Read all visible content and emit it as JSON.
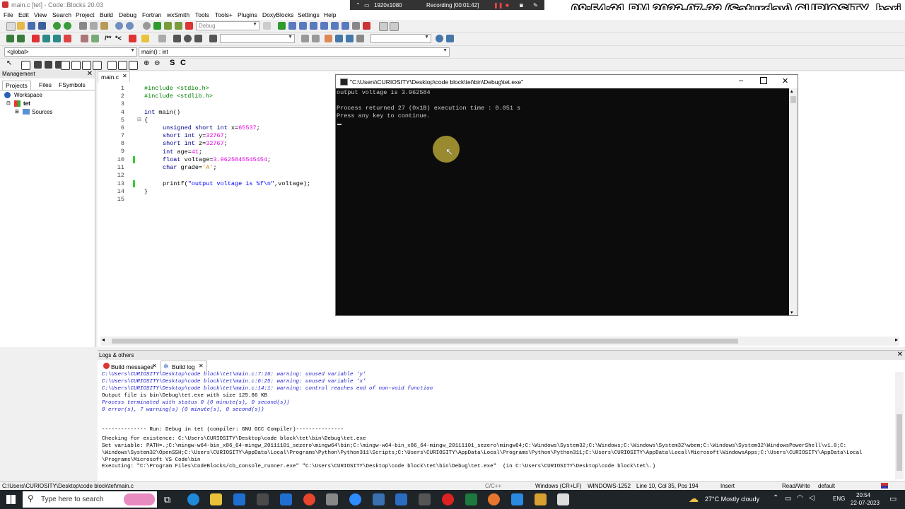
{
  "window": {
    "title": "main.c [tet] - Code::Blocks 20.03"
  },
  "recorder": {
    "resolution": "1920x1080",
    "status": "Recording [00:01:42]"
  },
  "overlay_clock": "08:54:31 PM  2023-07-22 (Saturday) CURIOSITY_hari",
  "menu": [
    "File",
    "Edit",
    "View",
    "Search",
    "Project",
    "Build",
    "Debug",
    "Fortran",
    "wxSmith",
    "Tools",
    "Tools+",
    "Plugins",
    "DoxyBlocks",
    "Settings",
    "Help"
  ],
  "toolbar": {
    "build_target": "Debug",
    "scope": "<global>",
    "symbol": "main() : int"
  },
  "management": {
    "title": "Management",
    "tabs": [
      "Projects",
      "Files",
      "FSymbols"
    ],
    "tree": {
      "workspace": "Workspace",
      "project": "tet",
      "folder": "Sources"
    }
  },
  "editor": {
    "tab": "main.c",
    "lines": [
      "1",
      "2",
      "3",
      "4",
      "5",
      "6",
      "7",
      "8",
      "9",
      "10",
      "11",
      "12",
      "13",
      "14",
      "15"
    ]
  },
  "code": {
    "l1": "#include <stdio.h>",
    "l2": "#include <stdlib.h>",
    "l4a": "int",
    "l4b": " main()",
    "l5": "{",
    "l6a": "unsigned short int",
    "l6b": " x=",
    "l6c": "65537",
    "l6d": ";",
    "l7a": "short int",
    "l7b": " y=",
    "l7c": "32767",
    "l7d": ";",
    "l8a": "short int",
    "l8b": " z=",
    "l8c": "32767",
    "l8d": ";",
    "l9a": "int",
    "l9b": " age=",
    "l9c": "41",
    "l9d": ";",
    "l10a": "float",
    "l10b": " voltage=",
    "l10c": "3.9625845545454",
    "l10d": ";",
    "l11a": "char",
    "l11b": " grade=",
    "l11c": "'A'",
    "l11d": ";",
    "l13a": "printf(",
    "l13b": "\"output voltage is %f\\n\"",
    "l13c": ",voltage);",
    "l14": "}"
  },
  "console": {
    "title": "\"C:\\Users\\CURIOSITY\\Desktop\\code block\\tet\\bin\\Debug\\tet.exe\"",
    "line1": "output voltage is 3.962584",
    "line2": "Process returned 27 (0x1B)   execution time : 0.051 s",
    "line3": "Press any key to continue."
  },
  "logs": {
    "title": "Logs & others",
    "tab_messages": "Build messages",
    "tab_log": "Build log",
    "lines": [
      "C:\\Users\\CURIOSITY\\Desktop\\code block\\tet\\main.c:7:16: warning: unused variable 'y'",
      "C:\\Users\\CURIOSITY\\Desktop\\code block\\tet\\main.c:6:25: warning: unused variable 'x'",
      "C:\\Users\\CURIOSITY\\Desktop\\code block\\tet\\main.c:14:1: warning: control reaches end of non-void function",
      "Output file is bin\\Debug\\tet.exe with size 125.86 KB",
      "Process terminated with status 0 (0 minute(s), 0 second(s))",
      "0 error(s), 7 warning(s) (0 minute(s), 0 second(s))",
      "-------------- Run: Debug in tet (compiler: GNU GCC Compiler)---------------",
      "Checking for existence: C:\\Users\\CURIOSITY\\Desktop\\code block\\tet\\bin\\Debug\\tet.exe",
      "Set variable: PATH=.;C:\\mingw-w64-bin_x86_64-mingw_20111101_sezero\\mingw64\\bin;C:\\mingw-w64-bin_x86_64-mingw_20111101_sezero\\mingw64;C:\\Windows\\System32;C:\\Windows;C:\\Windows\\System32\\wbem;C:\\Windows\\System32\\WindowsPowerShell\\v1.0;C:",
      "\\Windows\\System32\\OpenSSH;C:\\Users\\CURIOSITY\\AppData\\Local\\Programs\\Python\\Python311\\Scripts;C:\\Users\\CURIOSITY\\AppData\\Local\\Programs\\Python\\Python311;C:\\Users\\CURIOSITY\\AppData\\Local\\Microsoft\\WindowsApps;C:\\Users\\CURIOSITY\\AppData\\Local",
      "\\Programs\\Microsoft VS Code\\bin",
      "Executing: \"C:\\Program Files\\CodeBlocks/cb_console_runner.exe\" \"C:\\Users\\CURIOSITY\\Desktop\\code block\\tet\\bin\\Debug\\tet.exe\"  (in C:\\Users\\CURIOSITY\\Desktop\\code block\\tet\\.)"
    ]
  },
  "status": {
    "path": "C:\\Users\\CURIOSITY\\Desktop\\code block\\tet\\main.c",
    "lang": "C/C++",
    "eol": "Windows (CR+LF)",
    "encoding": "WINDOWS-1252",
    "position": "Line 10, Col 35, Pos 194",
    "mode": "Insert",
    "access": "Read/Write",
    "profile": "default"
  },
  "taskbar": {
    "search_placeholder": "Type here to search",
    "weather": "27°C  Mostly cloudy",
    "lang": "ENG",
    "time": "20:54",
    "date": "22-07-2023"
  },
  "colors": {
    "accent": "#1a1ad0",
    "console_bg": "#0c0c0c",
    "taskbar_bg": "#1f2429"
  }
}
